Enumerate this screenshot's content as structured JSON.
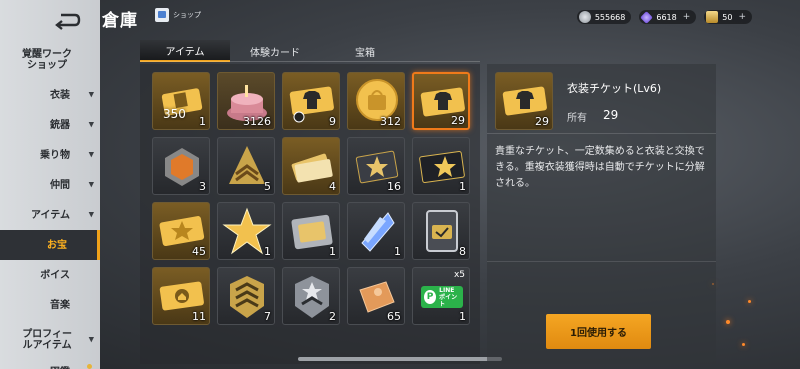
{
  "header": {
    "title": "倉庫",
    "shop_label": "ショップ"
  },
  "currencies": [
    {
      "value": "555668",
      "color": "#b9bec5"
    },
    {
      "value": "6618",
      "color": "#8a6cf0"
    },
    {
      "value": "50",
      "color": "#e8c46a"
    }
  ],
  "sidebar": {
    "items": [
      {
        "label": "覚醒ワーク\nショップ",
        "arrow": ""
      },
      {
        "label": "衣装",
        "arrow": "▼"
      },
      {
        "label": "銃器",
        "arrow": "▼"
      },
      {
        "label": "乗り物",
        "arrow": "▼"
      },
      {
        "label": "仲間",
        "arrow": "▼"
      },
      {
        "label": "アイテム",
        "arrow": "▼"
      },
      {
        "label": "お宝",
        "arrow": ""
      },
      {
        "label": "ボイス",
        "arrow": ""
      },
      {
        "label": "音楽",
        "arrow": ""
      },
      {
        "label": "プロフィー\nルアイテム",
        "arrow": "▼"
      },
      {
        "label": "図鑑",
        "arrow": ""
      }
    ]
  },
  "tabs": [
    "アイテム",
    "体験カード",
    "宝箱"
  ],
  "items": [
    {
      "count": "1",
      "big": "350"
    },
    {
      "count": "3126",
      "big": ""
    },
    {
      "count": "9",
      "big": ""
    },
    {
      "count": "312",
      "big": ""
    },
    {
      "count": "29",
      "big": ""
    },
    {
      "count": "3",
      "big": ""
    },
    {
      "count": "5",
      "big": ""
    },
    {
      "count": "4",
      "big": ""
    },
    {
      "count": "16",
      "big": ""
    },
    {
      "count": "1",
      "big": ""
    },
    {
      "count": "45",
      "big": ""
    },
    {
      "count": "1",
      "big": ""
    },
    {
      "count": "1",
      "big": ""
    },
    {
      "count": "1",
      "big": ""
    },
    {
      "count": "8",
      "big": ""
    },
    {
      "count": "11",
      "big": ""
    },
    {
      "count": "7",
      "big": ""
    },
    {
      "count": "2",
      "big": ""
    },
    {
      "count": "65",
      "big": ""
    },
    {
      "count": "1",
      "big": "",
      "badge": "x5",
      "line_text": "LINE\nポイント"
    }
  ],
  "detail": {
    "name": "衣装チケット(Lv6)",
    "thumb_count": "29",
    "owned_label": "所有",
    "owned_value": "29",
    "description": "貴重なチケット、一定数集めると衣装と交換できる。重複衣装獲得時は自動でチケットに分解される。",
    "use_button": "1回使用する"
  }
}
